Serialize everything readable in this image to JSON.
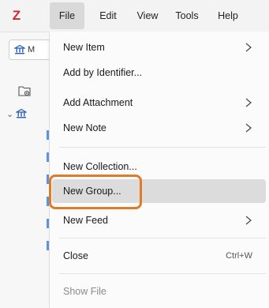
{
  "app": {
    "logo_letter": "Z"
  },
  "menubar": {
    "items": [
      {
        "label": "File"
      },
      {
        "label": "Edit"
      },
      {
        "label": "View"
      },
      {
        "label": "Tools"
      },
      {
        "label": "Help"
      }
    ]
  },
  "left_pane": {
    "tab_label": "M"
  },
  "file_menu": {
    "items": [
      {
        "label": "New Item",
        "submenu": true
      },
      {
        "label": "Add by Identifier...",
        "submenu": false
      },
      {
        "label": "Add Attachment",
        "submenu": true
      },
      {
        "label": "New Note",
        "submenu": true
      },
      {
        "label": "New Collection...",
        "submenu": false
      },
      {
        "label": "New Group...",
        "submenu": false,
        "highlighted": true
      },
      {
        "label": "New Feed",
        "submenu": true
      },
      {
        "label": "Close",
        "submenu": false,
        "shortcut": "Ctrl+W"
      },
      {
        "label": "Show File",
        "submenu": false,
        "disabled": true
      }
    ]
  },
  "colors": {
    "logo_red": "#cc2936",
    "highlight_orange": "#e07b2a",
    "hover_gray": "#dcdcdc",
    "tree_blue": "#3a7be0"
  }
}
